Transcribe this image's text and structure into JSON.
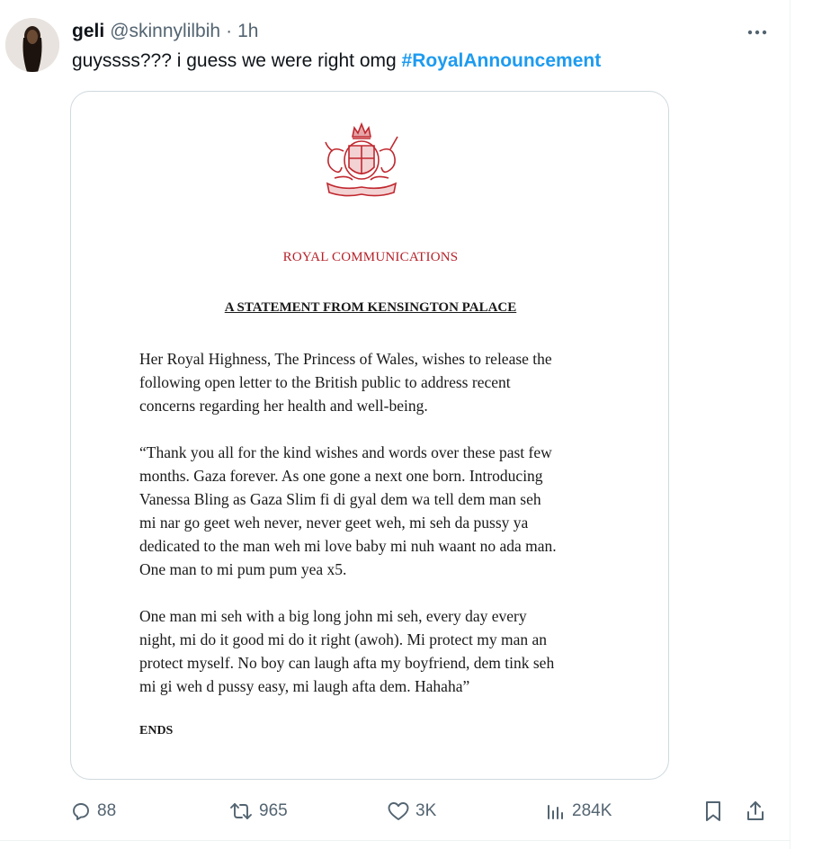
{
  "tweet": {
    "display_name": "geli",
    "handle": "@skinnylilbih",
    "separator": "·",
    "time": "1h",
    "text": "guyssss??? i guess we were right omg",
    "hashtag": "#RoyalAnnouncement"
  },
  "document": {
    "header": "ROYAL COMMUNICATIONS",
    "subheader": "A STATEMENT FROM KENSINGTON PALACE",
    "paragraph1": [
      "Her Royal Highness, The Princess of Wales, wishes to release the",
      "following open letter to the British public to address recent",
      "concerns regarding her health and well-being."
    ],
    "paragraph2": [
      "“Thank you all for the kind wishes and words over these past few",
      "months. Gaza forever. As one gone a next one born. Introducing",
      "Vanessa Bling as Gaza Slim fi di gyal dem wa tell dem man seh",
      "mi nar go geet weh never, never geet weh, mi seh da pussy ya",
      "dedicated to the man weh mi love baby mi nuh waant no ada man.",
      "One man to mi pum pum yea x5."
    ],
    "paragraph3": [
      "One man mi seh with a big long john mi seh, every day every",
      "night, mi do it good mi do it right (awoh). Mi protect my man an",
      "protect myself. No boy can laugh afta my boyfriend, dem tink seh",
      "mi gi weh d pussy easy, mi laugh afta dem. Hahaha”"
    ],
    "ends": "ENDS"
  },
  "actions": {
    "replies": "88",
    "reposts": "965",
    "likes": "3K",
    "views": "284K"
  },
  "colors": {
    "accent": "#1d9bf0",
    "muted": "#536471",
    "crest": "#c0282f"
  }
}
